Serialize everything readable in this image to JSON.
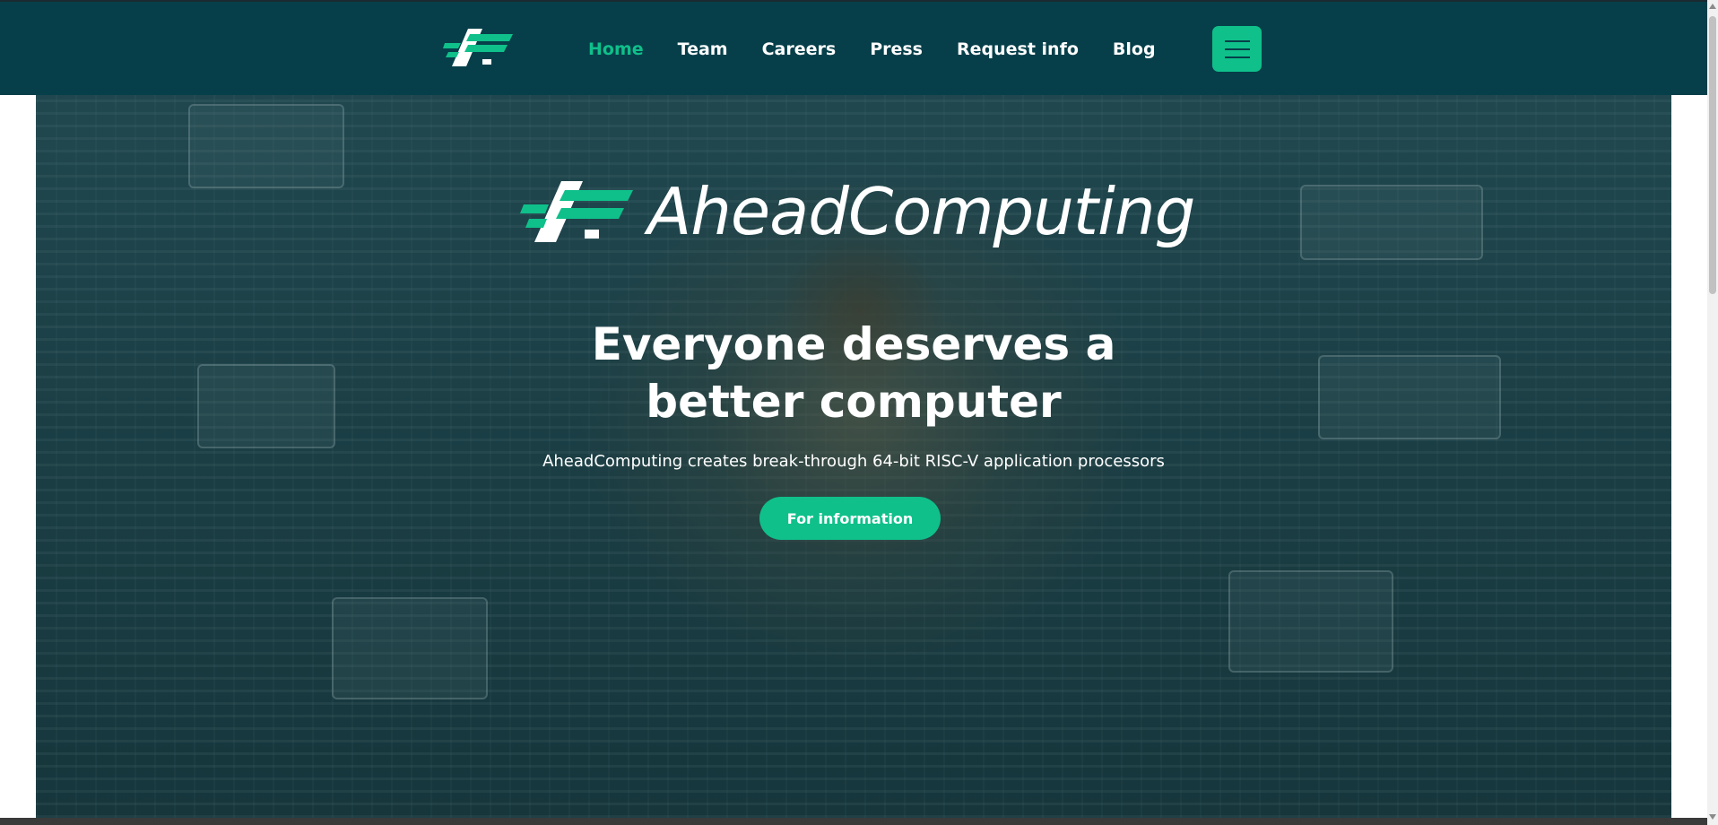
{
  "nav": {
    "logo_name": "aheadcomputing-logo",
    "links": [
      {
        "label": "Home",
        "active": true
      },
      {
        "label": "Team",
        "active": false
      },
      {
        "label": "Careers",
        "active": false
      },
      {
        "label": "Press",
        "active": false
      },
      {
        "label": "Request info",
        "active": false
      },
      {
        "label": "Blog",
        "active": false
      }
    ],
    "menu_icon": "hamburger-menu-icon"
  },
  "hero": {
    "brand_name": "AheadComputing",
    "title_line1": "Everyone deserves a",
    "title_line2": "better computer",
    "subtitle": "AheadComputing creates break-through 64-bit RISC-V application processors",
    "cta_label": "For information"
  },
  "colors": {
    "nav_background": "#063f4a",
    "accent": "#0fc08a",
    "text_light": "#ffffff"
  }
}
